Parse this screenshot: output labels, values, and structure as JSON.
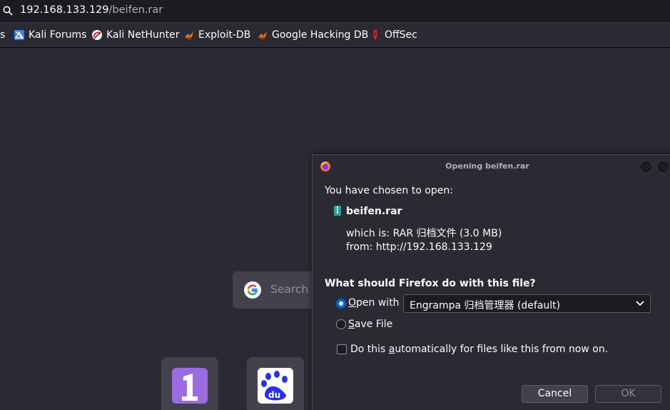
{
  "urlbar": {
    "host": "192.168.133.129",
    "path": "/beifen.rar"
  },
  "bookmarks": [
    {
      "label": "s",
      "icon": "bookmark-fragment"
    },
    {
      "label": "Kali Forums",
      "icon": "kali-forums-icon"
    },
    {
      "label": "Kali NetHunter",
      "icon": "kali-nethunter-icon"
    },
    {
      "label": "Exploit-DB",
      "icon": "exploit-db-icon"
    },
    {
      "label": "Google Hacking DB",
      "icon": "ghdb-icon"
    },
    {
      "label": "OffSec",
      "icon": "offsec-icon"
    }
  ],
  "newtab": {
    "search_placeholder": "Search"
  },
  "dialog": {
    "title": "Opening beifen.rar",
    "intro": "You have chosen to open:",
    "filename": "beifen.rar",
    "which_is_label": "which is:",
    "which_is_value": "RAR 归档文件 (3.0 MB)",
    "from_label": "from:",
    "from_value": "http://192.168.133.129",
    "question": "What should Firefox do with this file?",
    "open_with_prefix": "O",
    "open_with_rest": "pen with",
    "open_with_app": "Engrampa 归档管理器 (default)",
    "save_file_prefix": "S",
    "save_file_rest": "ave File",
    "auto_before": "Do this ",
    "auto_underline": "a",
    "auto_after": "utomatically for files like this from now on.",
    "cancel_label": "Cancel",
    "ok_label": "OK"
  },
  "colors": {
    "accent": "#0061e0",
    "background": "#2b2a33",
    "toolbar": "#1c1b22"
  }
}
